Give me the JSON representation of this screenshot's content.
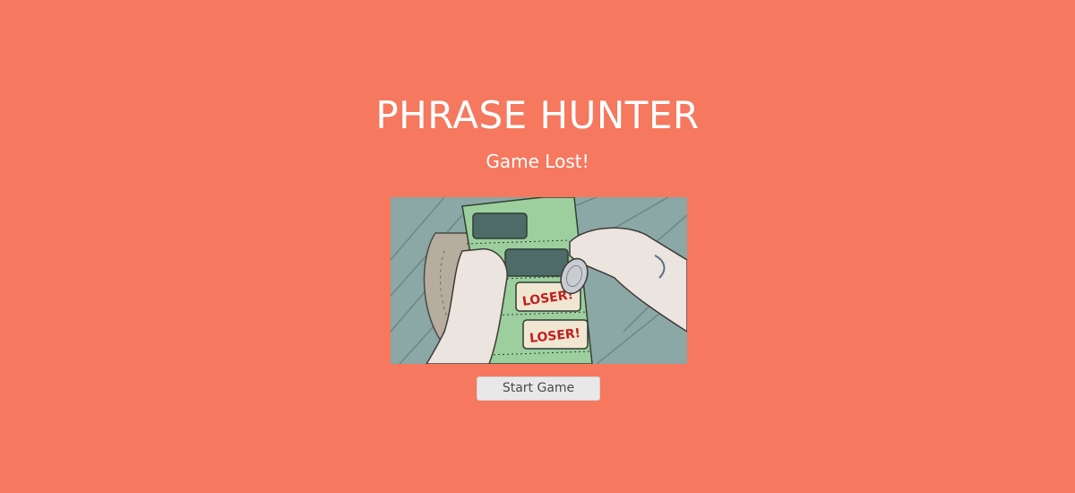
{
  "game": {
    "title": "PHRASE HUNTER",
    "result_message": "Game Lost!",
    "start_button_label": "Start Game"
  },
  "illustration": {
    "ticket_text": [
      "LOSER!",
      "LOSER!"
    ]
  },
  "colors": {
    "background": "#f5785f",
    "text": "#ffffff",
    "button_bg": "#e8e8e8",
    "button_text": "#4a4a4a"
  }
}
